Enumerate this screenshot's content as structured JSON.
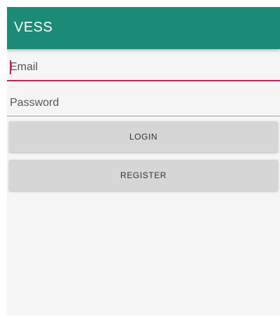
{
  "app_bar": {
    "title": "VESS",
    "color": "#1b8a76"
  },
  "form": {
    "email_placeholder": "Email",
    "password_placeholder": "Password",
    "focus_color": "#d81b60"
  },
  "buttons": {
    "login_label": "LOGIN",
    "register_label": "REGISTER"
  }
}
